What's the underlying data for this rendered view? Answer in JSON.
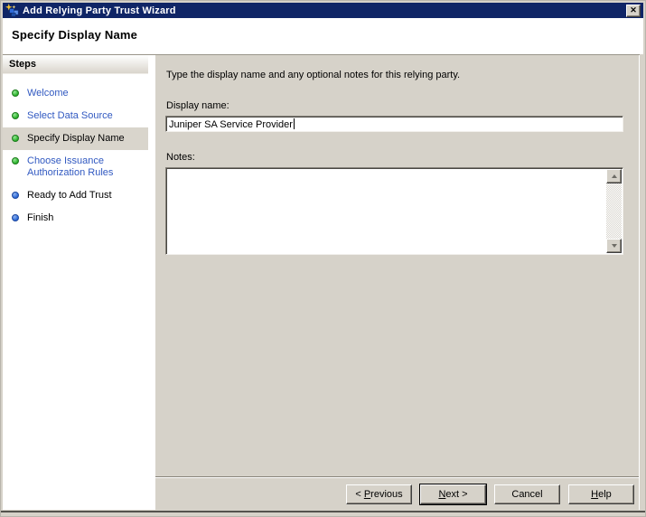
{
  "window": {
    "title": "Add Relying Party Trust Wizard",
    "close_glyph": "✕"
  },
  "page": {
    "heading": "Specify Display Name"
  },
  "sidebar": {
    "title": "Steps",
    "items": [
      {
        "label": "Welcome",
        "state": "done"
      },
      {
        "label": "Select Data Source",
        "state": "done"
      },
      {
        "label": "Specify Display Name",
        "state": "current"
      },
      {
        "label": "Choose Issuance Authorization Rules",
        "state": "done"
      },
      {
        "label": "Ready to Add Trust",
        "state": "upcoming"
      },
      {
        "label": "Finish",
        "state": "upcoming"
      }
    ]
  },
  "main": {
    "instruction": "Type the display name and any optional notes for this relying party.",
    "display_name": {
      "label": "Display name:",
      "value": "Juniper SA Service Provider"
    },
    "notes": {
      "label": "Notes:",
      "value": ""
    }
  },
  "buttons": {
    "previous": {
      "pre": "< ",
      "key": "P",
      "post": "revious"
    },
    "next": {
      "pre": "",
      "key": "N",
      "post": "ext >"
    },
    "cancel": {
      "pre": "Cancel",
      "key": "",
      "post": ""
    },
    "help": {
      "pre": "",
      "key": "H",
      "post": "elp"
    }
  },
  "colors": {
    "titlebar_bg": "#0f2566",
    "body_face": "#d6d2c9",
    "step_link_blue": "#3159c1",
    "done_bullet_green": "#2eb52e",
    "upcoming_bullet_blue": "#2f6bd9",
    "highlight_row": "#d9d5cc"
  }
}
